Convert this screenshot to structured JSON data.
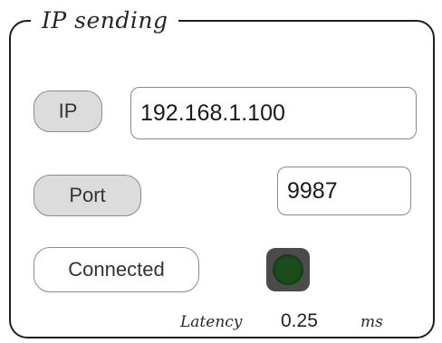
{
  "panel": {
    "title": "IP sending"
  },
  "ip": {
    "label": "IP",
    "value": "192.168.1.100"
  },
  "port": {
    "label": "Port",
    "value": "9987"
  },
  "connection": {
    "status_label": "Connected",
    "indicator_color": "#1b4d1b"
  },
  "latency": {
    "label": "Latency",
    "value": "0.25",
    "unit": "ms"
  }
}
